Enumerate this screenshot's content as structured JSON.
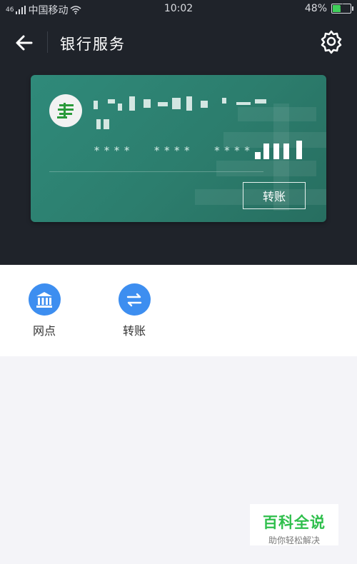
{
  "status_bar": {
    "carrier": "中国移动",
    "signal_text": "46",
    "time": "10:02",
    "battery": "48%",
    "battery_level": 0.48
  },
  "header": {
    "title": "银行服务",
    "back_icon": "arrow-left-icon",
    "settings_icon": "gear-icon"
  },
  "card": {
    "masked_number": "****  ****  ****",
    "transfer_label": "转账",
    "bank_name": "",
    "last_digits": "",
    "color": "#2f8a7a"
  },
  "actions": [
    {
      "label": "网点",
      "icon": "bank-icon"
    },
    {
      "label": "转账",
      "icon": "transfer-icon"
    }
  ],
  "watermark": {
    "brand": "百科全说",
    "slogan": "助你轻松解决"
  },
  "colors": {
    "dark_bg": "#1f232a",
    "accent_blue": "#3d8ef0",
    "brand_green": "#2fbf4c"
  }
}
